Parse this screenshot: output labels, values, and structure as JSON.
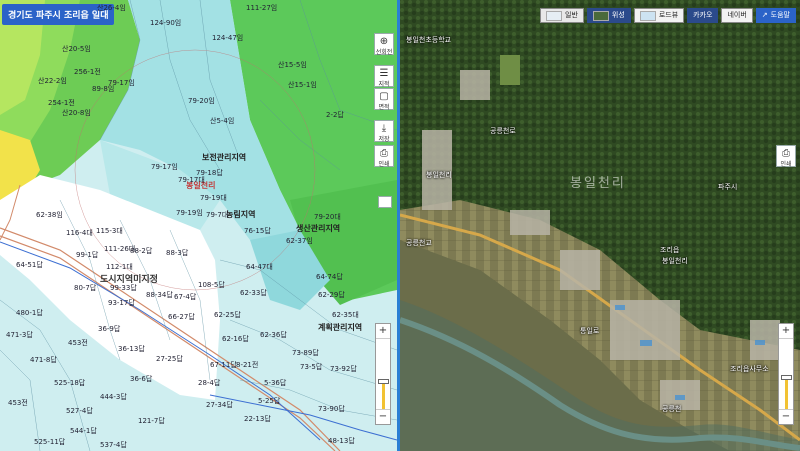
{
  "left_map": {
    "title": "경기도 파주시 조리읍 일대",
    "zone_labels": [
      "도시지역미지정",
      "봉일천리"
    ],
    "black_labels": [
      "보전관리지역",
      "농림지역",
      "생산관리지역",
      "계획관리지역"
    ],
    "parcels": [
      "산26-4임",
      "산20-5임",
      "256-1전",
      "산22-2임",
      "254-1전",
      "산20-8임",
      "89-8임",
      "79-17임",
      "124-90임",
      "111-27임",
      "124-47임",
      "산15-5임",
      "산15-1임",
      "79-20임",
      "산5-4임",
      "2-2답",
      "79-17임",
      "79-18답",
      "79-19대",
      "79-19임",
      "79-17대",
      "79-7대",
      "79-20대",
      "62-37임",
      "62-38임",
      "116-4대",
      "115-3대",
      "111-26대",
      "88-2답",
      "88-3답",
      "76-15답",
      "64-47대",
      "64-51답",
      "99-1답",
      "112-1대",
      "88-34답",
      "80-7답",
      "99-33답",
      "108-5답",
      "64-74답",
      "62-33답",
      "62-29답",
      "62-35대",
      "93-17답",
      "67-4답",
      "66-27답",
      "62-25답",
      "62-36답",
      "62-16답",
      "73-89답",
      "36-9답",
      "453전",
      "36-13답",
      "27-25답",
      "67-11답",
      "73-5답",
      "73-92답",
      "8-21전",
      "5-36답",
      "36-6답",
      "28-4답",
      "525-18답",
      "444-3답",
      "527-4답",
      "121-7답",
      "27-34답",
      "5-25답",
      "73-90답",
      "525-11답",
      "544-1답",
      "537-4답",
      "22-13답",
      "48-13답",
      "480-1답",
      "471-3답",
      "471-8답",
      "453전"
    ]
  },
  "tools_left": {
    "rotate": "선회전",
    "map_type": "지적",
    "area": "면적",
    "save": "저장",
    "print": "인쇄"
  },
  "right_map": {
    "toolbar": {
      "general": "일반",
      "satellite": "위성",
      "road": "로드뷰",
      "kakao": "카카오",
      "naver": "네이버",
      "help": "도움말"
    },
    "print": "인쇄",
    "big_label": "봉일천리",
    "labels": [
      "공릉천로",
      "공릉천교",
      "봉일천리",
      "통일로",
      "조리읍",
      "공릉천",
      "파주시",
      "봉일천초등학교",
      "봉일천리",
      "조리읍사무소"
    ]
  },
  "zoom_left": {
    "level": 0.62
  },
  "zoom_right": {
    "level": 0.55
  },
  "colors": {
    "accent": "#2b63c8",
    "divider": "#2a7fd4",
    "green_zone": "#5cc95a",
    "light_cyan": "#cfeef0",
    "white_zone": "#ffffff"
  }
}
